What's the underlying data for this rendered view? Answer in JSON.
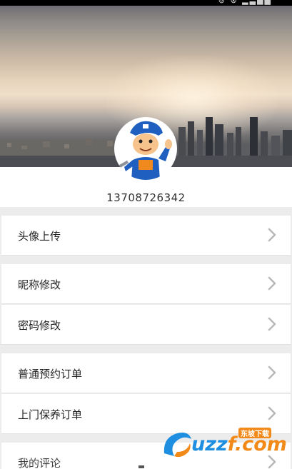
{
  "status_bar": {
    "icons_text": "⊚ ⊗ ▂▃▅▇"
  },
  "profile": {
    "phone": "13708726342"
  },
  "menu": {
    "items": [
      {
        "label": "头像上传"
      },
      {
        "label": "昵称修改"
      },
      {
        "label": "密码修改"
      },
      {
        "label": "普通预约订单"
      },
      {
        "label": "上门保养订单"
      },
      {
        "label": "我的评论"
      }
    ]
  },
  "watermark": {
    "brand_prefix": "uzz",
    "brand_suffix": "f.com",
    "tag": "东坡下载"
  },
  "colors": {
    "section_gap": "#ececec",
    "chevron": "#b8b8b8",
    "brand_blue": "#1d8ee0",
    "brand_orange": "#f28a1a"
  }
}
